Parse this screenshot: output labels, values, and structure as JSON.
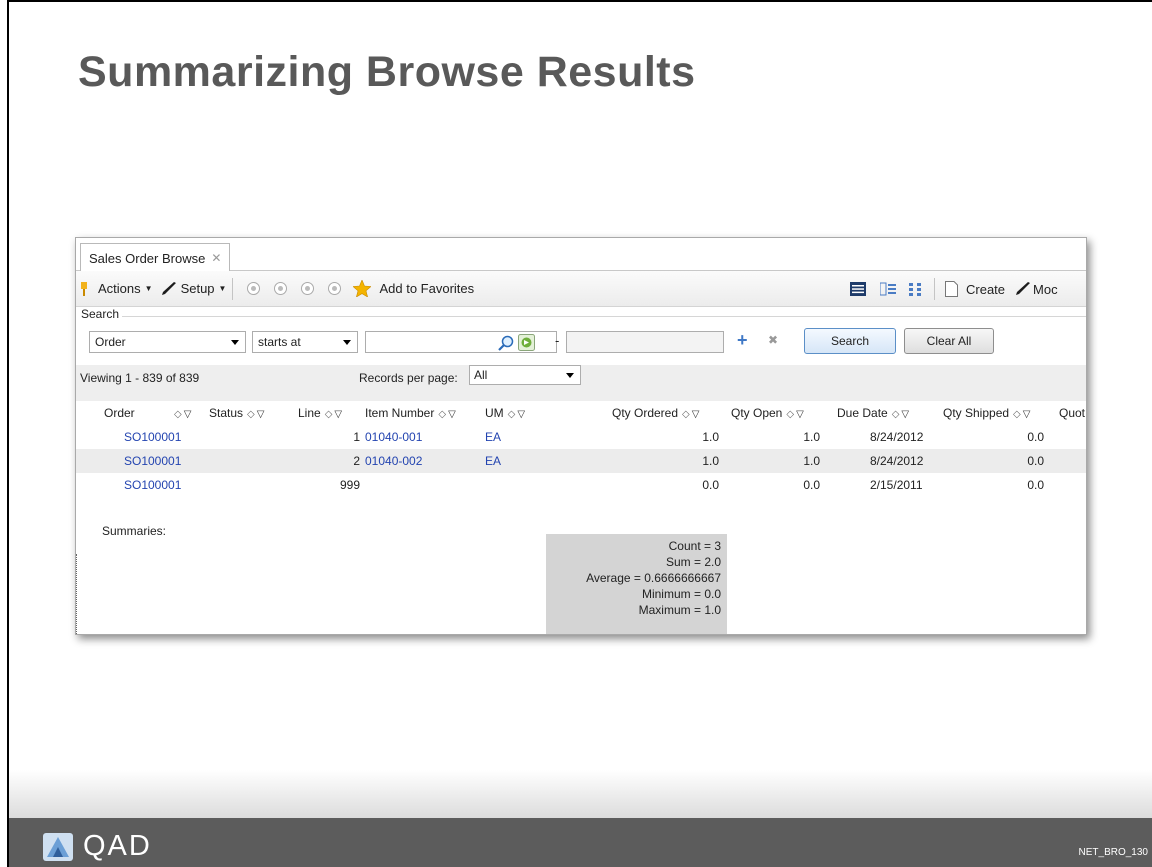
{
  "slide": {
    "title": "Summarizing Browse Results",
    "code": "NET_BRO_130",
    "logo_text": "QAD"
  },
  "window": {
    "tab_label": "Sales Order Browse",
    "tab_close": "✕",
    "toolbar": {
      "actions_label": "Actions",
      "setup_label": "Setup",
      "add_favorites_label": "Add to Favorites",
      "create_label": "Create",
      "modify_label": "Moc"
    },
    "search": {
      "section_label": "Search",
      "field_value": "Order",
      "operator_value": "starts at",
      "value1": "",
      "dash": "-",
      "value2": "",
      "search_button": "Search",
      "clear_button": "Clear All"
    },
    "viewing": {
      "text": "Viewing 1 - 839 of 839",
      "records_label": "Records per page:",
      "records_value": "All"
    },
    "grid": {
      "columns": [
        "Order",
        "Status",
        "Line",
        "Item Number",
        "UM",
        "Qty Ordered",
        "Qty Open",
        "Due Date",
        "Qty Shipped",
        "Quot"
      ],
      "rows": [
        {
          "order": "SO100001",
          "status": "",
          "line": "1",
          "item": "01040-001",
          "um": "EA",
          "qty_ordered": "1.0",
          "qty_open": "1.0",
          "due_date": "8/24/2012",
          "qty_shipped": "0.0"
        },
        {
          "order": "SO100001",
          "status": "",
          "line": "2",
          "item": "01040-002",
          "um": "EA",
          "qty_ordered": "1.0",
          "qty_open": "1.0",
          "due_date": "8/24/2012",
          "qty_shipped": "0.0"
        },
        {
          "order": "SO100001",
          "status": "",
          "line": "999",
          "item": "",
          "um": "",
          "qty_ordered": "0.0",
          "qty_open": "0.0",
          "due_date": "2/15/2011",
          "qty_shipped": "0.0"
        }
      ]
    },
    "summaries": {
      "label": "Summaries:",
      "count": "Count = 3",
      "sum": "Sum = 2.0",
      "average": "Average = 0.6666666667",
      "minimum": "Minimum = 0.0",
      "maximum": "Maximum = 1.0"
    }
  },
  "colors": {
    "title": "#595959",
    "footer": "#5c5c5c",
    "link": "#2344b0",
    "summary_bg": "#d4d4d4"
  }
}
